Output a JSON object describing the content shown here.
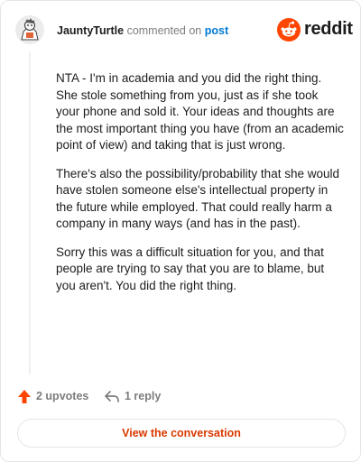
{
  "comment": {
    "username": "JauntyTurtle",
    "action_text": " commented on ",
    "post_link": "post",
    "paragraphs": [
      "NTA - I'm in academia and you did the right thing. She stole something from you, just as if she took your phone and sold it. Your ideas and thoughts are the most important thing you have (from an academic point of view) and taking that is just wrong.",
      "There's also the possibility/probability that she would have stolen someone else's intellectual property in the future while employed. That could really harm a company in many ways (and has in the past).",
      "Sorry this was a difficult situation for you, and that people are trying to say that you are to blame, but you aren't. You did the right thing."
    ]
  },
  "brand": {
    "name": "reddit",
    "icon": "reddit-logo-icon",
    "color": "#ff4500"
  },
  "actions": {
    "upvotes_label": "2 upvotes",
    "upvote_icon": "upvote-arrow-icon",
    "upvote_color": "#ff4500",
    "replies_label": "1 reply",
    "reply_icon": "reply-arrow-icon"
  },
  "footer": {
    "view_conversation_label": "View the conversation",
    "accent": "#d93900"
  }
}
